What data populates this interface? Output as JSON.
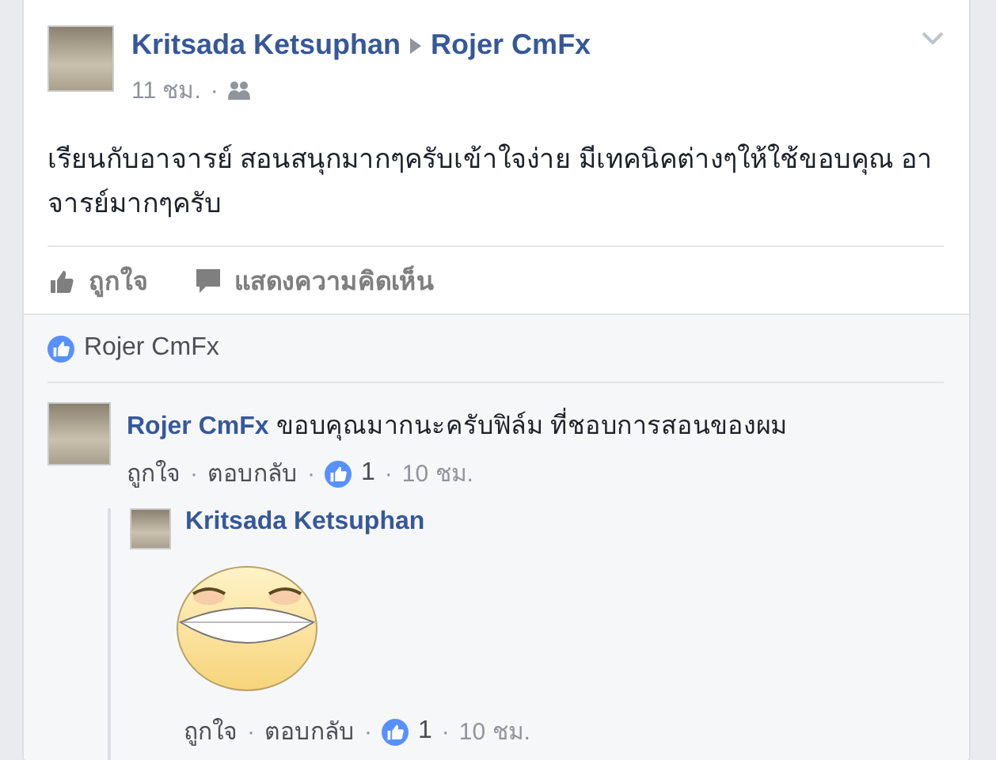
{
  "post": {
    "author": "Kritsada Ketsuphan",
    "target": "Rojer CmFx",
    "time": "11 ชม.",
    "separator": "·",
    "text": "เรียนกับอาจารย์ สอนสนุกมากๆครับเข้าใจง่าย มีเทคนิคต่างๆให้ใช้ขอบคุณ อาจารย์มากๆครับ",
    "actions": [
      {
        "kind": "like",
        "label": "ถูกใจ"
      },
      {
        "kind": "comment",
        "label": "แสดงความคิดเห็น"
      }
    ]
  },
  "likes": {
    "names": "Rojer CmFx"
  },
  "comment": {
    "author": "Rojer CmFx",
    "text": "ขอบคุณมากนะครับฟิล์ม ที่ชอบการสอนของผม",
    "like": "ถูกใจ",
    "reply": "ตอบกลับ",
    "reactions": "1",
    "time": "10 ชม.",
    "separators": [
      "·",
      "·",
      "·"
    ],
    "replies": [
      {
        "author": "Kritsada Ketsuphan",
        "kind": "sticker",
        "like": "ถูกใจ",
        "reply": "ตอบกลับ",
        "reactions": "1",
        "time": "10 ชม.",
        "separators": [
          "·",
          "·",
          "·"
        ]
      }
    ]
  }
}
